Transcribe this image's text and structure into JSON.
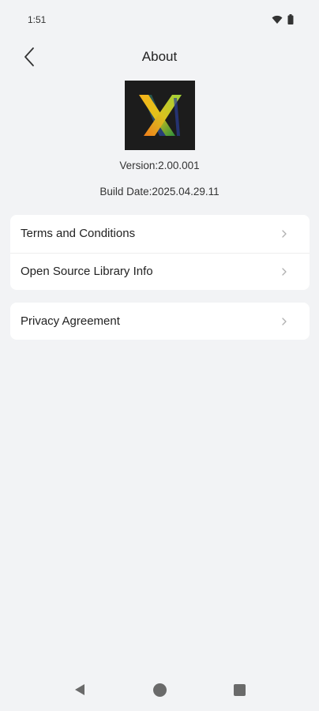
{
  "status_bar": {
    "time": "1:51",
    "icons": [
      "wifi-icon",
      "battery-icon"
    ]
  },
  "header": {
    "title": "About",
    "back_icon": "chevron-left-icon"
  },
  "app_info": {
    "logo_icon": "app-logo-x",
    "version": "Version:2.00.001",
    "build_date": "Build Date:2025.04.29.11"
  },
  "menu": {
    "group1": [
      {
        "label": "Terms and Conditions"
      },
      {
        "label": "Open Source Library Info"
      }
    ],
    "group2": [
      {
        "label": "Privacy Agreement"
      }
    ],
    "chevron_icon": "chevron-right-icon"
  },
  "nav_bar": {
    "icons": [
      "nav-back-icon",
      "nav-home-icon",
      "nav-recents-icon"
    ]
  },
  "colors": {
    "background": "#f2f3f5",
    "card": "#ffffff",
    "text": "#222222",
    "chevron": "#b0b0b0"
  }
}
